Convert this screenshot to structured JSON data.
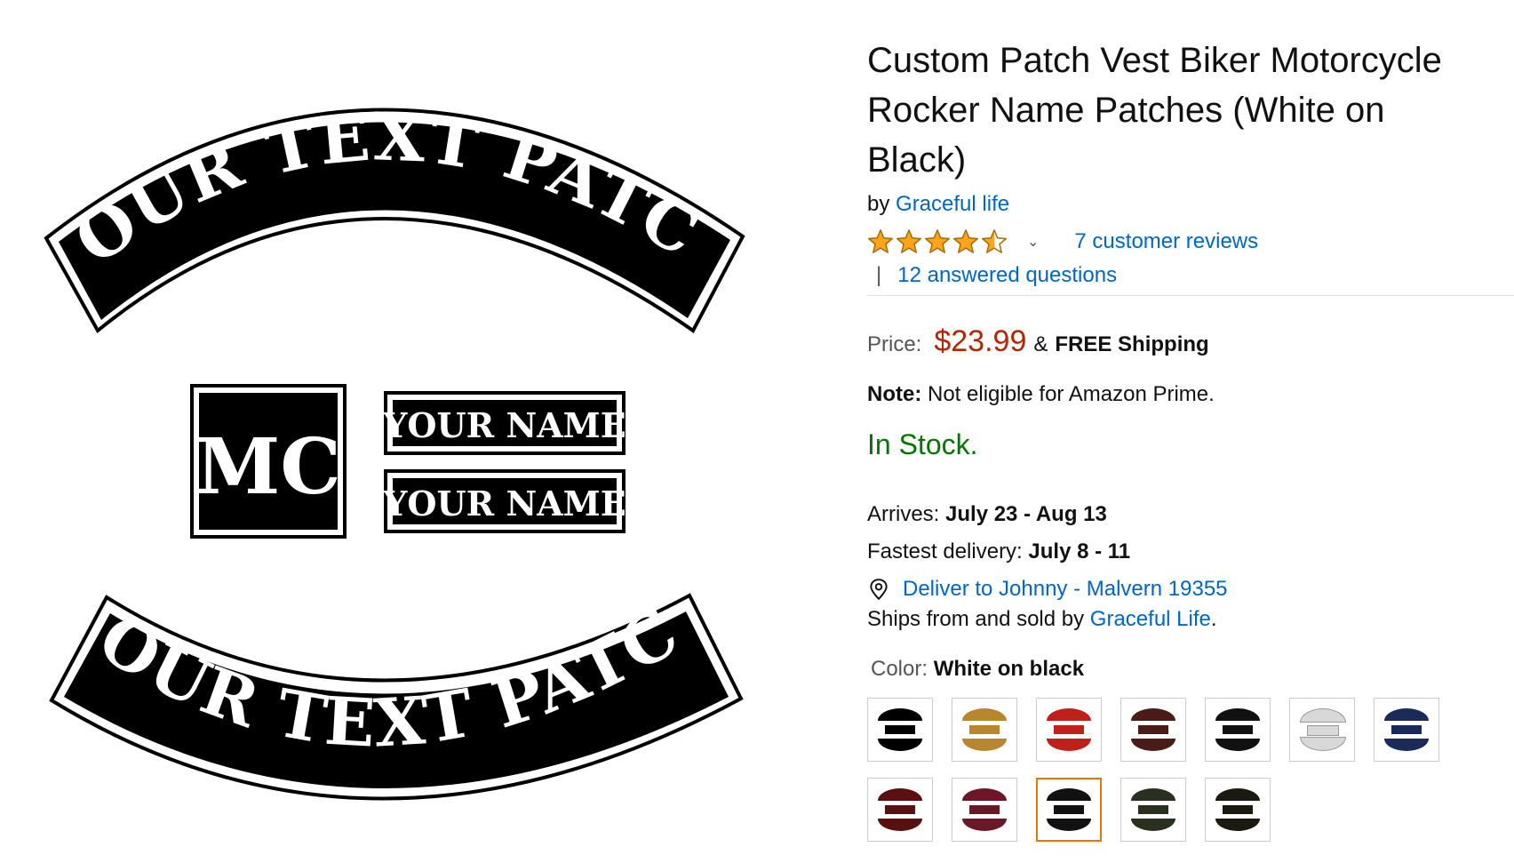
{
  "product": {
    "title": "Custom Patch Vest Biker Motorcycle Rocker Name Patches (White on Black)",
    "by_label": "by",
    "brand": "Graceful life",
    "rating": 4.5,
    "reviews_link": "7 customer reviews",
    "qa_separator": "|",
    "questions_link": "12 answered questions",
    "price_label": "Price:",
    "price": "$23.99",
    "amp": "&",
    "shipping": "FREE Shipping",
    "note_label": "Note:",
    "note_text": "Not eligible for Amazon Prime.",
    "stock": "In Stock.",
    "arrives_label": "Arrives:",
    "arrives_value": "July 23 - Aug 13",
    "fastest_label": "Fastest delivery:",
    "fastest_value": "July 8 - 11",
    "deliver_link": "Deliver to Johnny - Malvern 19355",
    "ships_prefix": "Ships from and sold by",
    "ships_seller": "Graceful Life",
    "ships_suffix": ".",
    "color_label": "Color:",
    "color_value": "White on black"
  },
  "image": {
    "top_rocker": "YOUR TEXT PATCH",
    "mc": "MC",
    "name1": "YOUR NAME",
    "name2": "YOUR NAME",
    "bottom_rocker": "YOUR TEXT PATCH"
  },
  "swatches": [
    {
      "color": "#000000",
      "selected": false
    },
    {
      "color": "#b8862e",
      "selected": false
    },
    {
      "color": "#c0201a",
      "selected": false
    },
    {
      "color": "#4a1c18",
      "selected": false
    },
    {
      "color": "#111111",
      "selected": false
    },
    {
      "color": "#d8d8d8",
      "selected": false
    },
    {
      "color": "#1a2a5a",
      "selected": false
    },
    {
      "color": "#5a1010",
      "selected": false
    },
    {
      "color": "#6a1828",
      "selected": false
    },
    {
      "color": "#111111",
      "selected": true
    },
    {
      "color": "#2a3020",
      "selected": false
    },
    {
      "color": "#1a1a10",
      "selected": false
    }
  ],
  "colors": {
    "link": "#0066c0",
    "price": "#b12704",
    "stock": "#007600",
    "star": "#ffa41c",
    "selected_border": "#e77600"
  }
}
